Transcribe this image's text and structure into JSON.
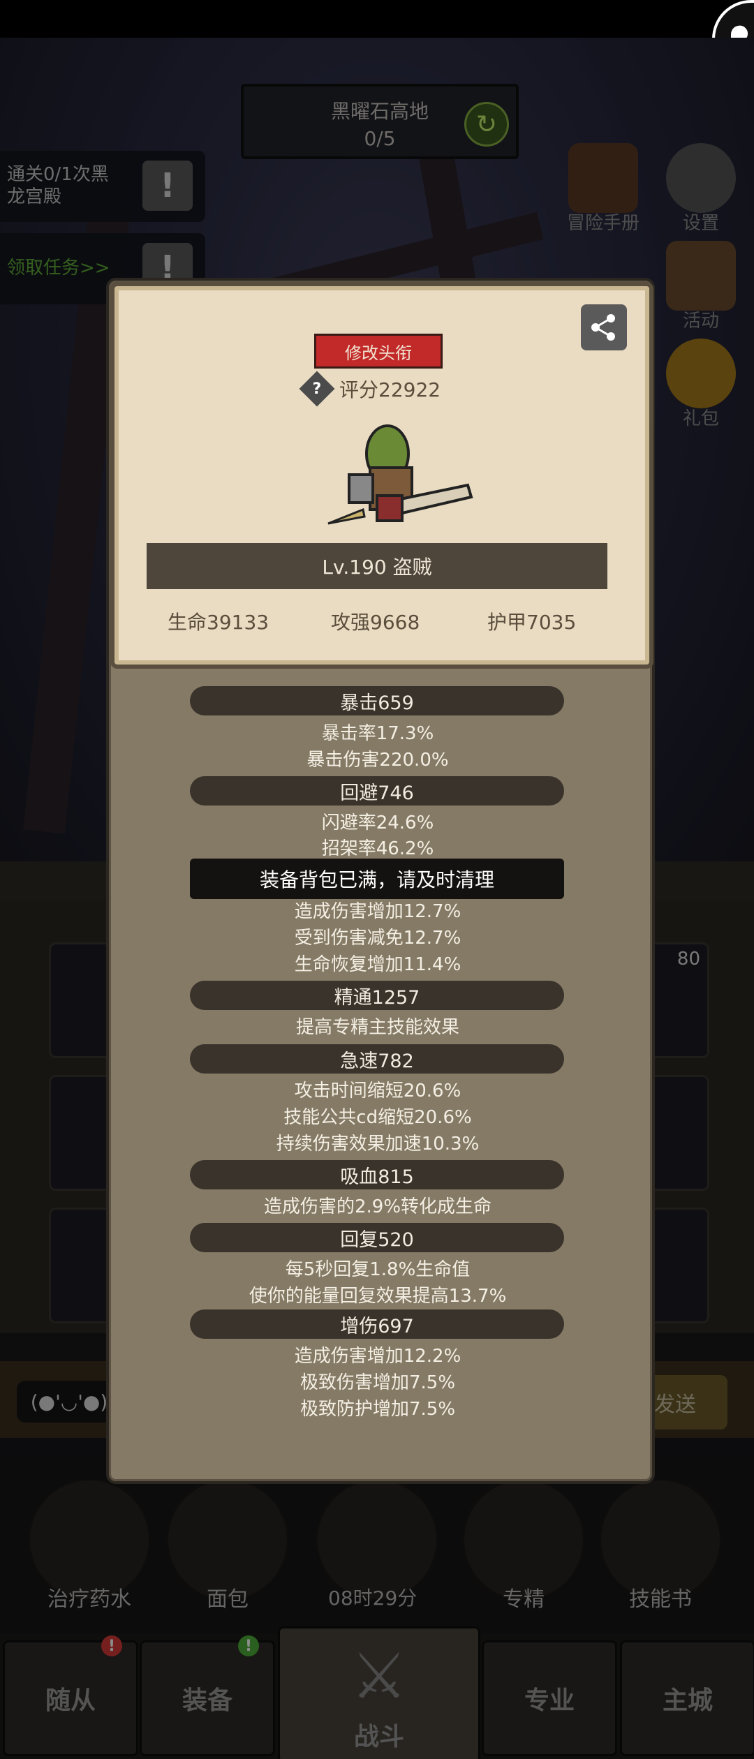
{
  "background": {
    "stage": {
      "name": "黑曜石高地",
      "progress": "0/5"
    },
    "quests": [
      {
        "text": "通关0/1次黑龙宫殿",
        "color": "#c8c8c8"
      },
      {
        "text": "领取任务>>",
        "color": "#5fae3a"
      }
    ],
    "side_icons": [
      {
        "label": "冒险手册",
        "icon": "book-icon"
      },
      {
        "label": "设置",
        "icon": "gear-icon"
      },
      {
        "label": "活动",
        "icon": "calendar-icon"
      },
      {
        "label": "礼包",
        "icon": "gift-icon"
      }
    ],
    "chat": {
      "emoji": "(●'◡'●)",
      "send_label": "发送"
    },
    "slot_count": "80",
    "quick_items": [
      {
        "label": "治疗药水",
        "icon": "potion-icon"
      },
      {
        "label": "面包",
        "icon": "bread-icon"
      },
      {
        "label": "",
        "icon": "chest-icon"
      },
      {
        "label": "专精",
        "icon": "specialization-icon"
      },
      {
        "label": "技能书",
        "icon": "skill-book-icon"
      }
    ],
    "timer": "08时29分",
    "tabs": [
      {
        "label": "随从",
        "badge": "!",
        "badge_color": "#d63a3a"
      },
      {
        "label": "装备",
        "badge": "!",
        "badge_color": "#4fae3a"
      },
      {
        "label": "战斗",
        "active": true
      },
      {
        "label": "专业"
      },
      {
        "label": "主城"
      }
    ]
  },
  "profile": {
    "title_button": "修改头衔",
    "score_label": "评分22922",
    "level_class": "Lv.190 盗贼",
    "basic_stats": [
      "生命39133",
      "攻强9668",
      "护甲7035"
    ]
  },
  "stats": [
    {
      "header": "暴击659",
      "lines": [
        "暴击率17.3%",
        "暴击伤害220.0%"
      ]
    },
    {
      "header": "回避746",
      "lines": [
        "闪避率24.6%",
        "招架率46.2%"
      ]
    },
    {
      "header": "",
      "lines": [
        "造成伤害增加12.7%",
        "受到伤害减免12.7%",
        "生命恢复增加11.4%"
      ]
    },
    {
      "header": "精通1257",
      "lines": [
        "提高专精主技能效果"
      ]
    },
    {
      "header": "急速782",
      "lines": [
        "攻击时间缩短20.6%",
        "技能公共cd缩短20.6%",
        "持续伤害效果加速10.3%"
      ]
    },
    {
      "header": "吸血815",
      "lines": [
        "造成伤害的2.9%转化成生命"
      ]
    },
    {
      "header": "回复520",
      "lines": [
        "每5秒回复1.8%生命值",
        "使你的能量回复效果提高13.7%"
      ]
    },
    {
      "header": "增伤697",
      "lines": [
        "造成伤害增加12.2%",
        "极致伤害增加7.5%",
        "极致防护增加7.5%"
      ]
    }
  ],
  "toast": "装备背包已满，请及时清理",
  "colors": {
    "title_red": "#c22a2a",
    "card_bg": "#e9dcc2",
    "panel_bg": "#857a65",
    "pill_bg": "#3a332b"
  }
}
